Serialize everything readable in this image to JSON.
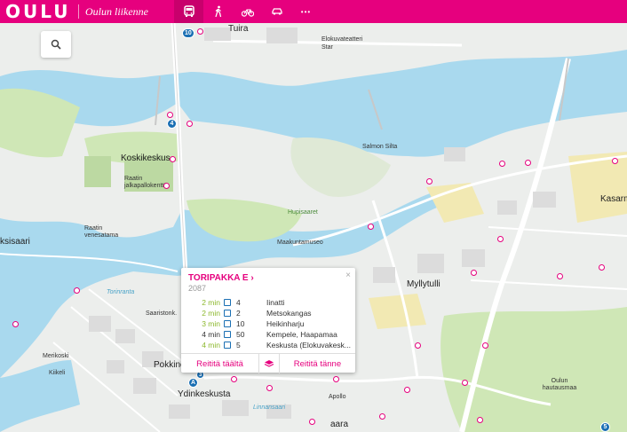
{
  "header": {
    "logo": "OULU",
    "subtitle": "Oulun liikenne",
    "modes": [
      {
        "icon": "bus-icon",
        "active": true
      },
      {
        "icon": "walk-icon",
        "active": false
      },
      {
        "icon": "bike-icon",
        "active": false
      },
      {
        "icon": "car-icon",
        "active": false
      },
      {
        "icon": "more-icon",
        "label": "•••"
      }
    ]
  },
  "search": {
    "icon": "search-icon"
  },
  "map": {
    "labels": {
      "tuira": "Tuira",
      "elokuvateatteri": "Elokuvateatteri Star",
      "koskikeskus": "Koskikeskus",
      "raatin": "Raatin jalkapallokenttä",
      "salmen_silta": "Salmon Silta",
      "hupisaaret": "Hupisaaret",
      "maakuntamuseo": "Maakuntamuseo",
      "lasaari": "ksisaari",
      "myllytulli": "Myllytulli",
      "kasarmi": "Kasarmi",
      "pokkinen": "Pokkinen",
      "ydinkeskusta": "Ydinkeskusta",
      "merikoski": "Merikoski",
      "kiikeli": "Kiikeli",
      "raatin_venesatama": "Raatin venesatama",
      "torinranta": "Torinranta",
      "oulun_hautausmaa": "Oulun hautausmaa",
      "apollo": "Apollo",
      "linnansaari": "Linnansaari",
      "saaristonk": "Saaristonk.",
      "aara": "aara"
    },
    "route_badges": {
      "b10": "10",
      "b4": "4",
      "b5": "5",
      "b3": "3"
    }
  },
  "popup": {
    "title": "TORIPAKKA E ›",
    "code": "2087",
    "close": "×",
    "departures": [
      {
        "time": "2 min",
        "route": "4",
        "destination": "Iinatti",
        "realtime": true
      },
      {
        "time": "2 min",
        "route": "2",
        "destination": "Metsokangas",
        "realtime": true
      },
      {
        "time": "3 min",
        "route": "10",
        "destination": "Heikinharju",
        "realtime": true
      },
      {
        "time": "4 min",
        "route": "50",
        "destination": "Kempele, Haapamaa",
        "realtime": false
      },
      {
        "time": "4 min",
        "route": "5",
        "destination": "Keskusta (Elokuvakesk...",
        "realtime": true
      }
    ],
    "actions": {
      "route_from": "Reititä täältä",
      "route_to": "Reititä tänne",
      "middle_icon": "layers-icon"
    }
  },
  "selected_marker": {
    "label": "A"
  },
  "colors": {
    "brand": "#e6007e",
    "water": "#a9d9ee",
    "park": "#cfe7b6",
    "realtime_time": "#8cb82d",
    "bus_blue": "#1a6fb3"
  }
}
